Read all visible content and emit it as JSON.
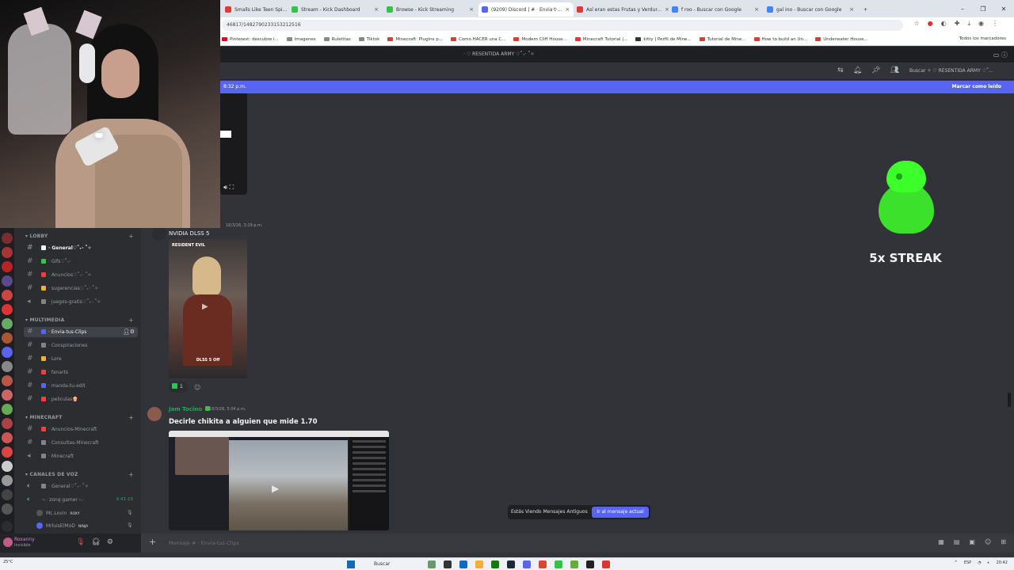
{
  "browser": {
    "tabs": [
      {
        "label": "Smalls Like Teen Spi...",
        "color": "#e23838"
      },
      {
        "label": "Stream - Kick Dashboard",
        "color": "#35c246"
      },
      {
        "label": "Browse - Kick Streaming",
        "color": "#35c246"
      },
      {
        "label": "(9209) Discord | # · Envia·t·...",
        "color": "#5865f2"
      },
      {
        "label": "Así eran estas Frutas y Verdur...",
        "color": "#e23838"
      },
      {
        "label": "f roo - Buscar con Google",
        "color": "#4285f4"
      },
      {
        "label": "gal ino - Buscar con Google",
        "color": "#4285f4"
      }
    ],
    "url": "46817/1482790233153212516",
    "bookmarks": [
      {
        "label": "Pinterest: descubre i...",
        "color": "#e60023"
      },
      {
        "label": "Imagenes",
        "color": "#888"
      },
      {
        "label": "Ruletitas",
        "color": "#888"
      },
      {
        "label": "Tiktok",
        "color": "#888"
      },
      {
        "label": "Minecraft: Plugins p...",
        "color": "#e23838"
      },
      {
        "label": "Como HACER una C...",
        "color": "#e23838"
      },
      {
        "label": "Modern Cliff House...",
        "color": "#e23838"
      },
      {
        "label": "Minecraft Tutorial |...",
        "color": "#e23838"
      },
      {
        "label": "kitty | Perfil de Mine...",
        "color": "#333"
      },
      {
        "label": "Tutorial de Mine...",
        "color": "#e23838"
      },
      {
        "label": "How to build an Un...",
        "color": "#e23838"
      },
      {
        "label": "Underwater House...",
        "color": "#e23838"
      }
    ],
    "bookmarks_all": "Todos los marcadores"
  },
  "discord": {
    "title": "· ♡ RESENTIDA ARMY ♡˚₊‧ ˚✧",
    "search_placeholder": "Buscar ✧ ♡ RESENTIDA ARMY ♡˚...",
    "new_bar_time": "8:32 p.m.",
    "mark_read": "Marcar como leído",
    "categories": {
      "lobby": "LOBBY",
      "multimedia": "MULTIMEDIA",
      "minecraft": "MINECRAFT",
      "voice": "CANALES DE VOZ"
    },
    "channels": [
      {
        "label": "· General♡˚₊‧ ˚✧",
        "color": "#f2f3f5"
      },
      {
        "label": "· Gifs♡˚₊‧",
        "color": "#35c246"
      },
      {
        "label": "· Anuncios♡˚₊‧ ˚✧",
        "color": "#f23f43"
      },
      {
        "label": "· sugerencias♡˚₊‧ ˚✧",
        "color": "#f0b232"
      },
      {
        "label": "· juegos-gratis♡˚₊‧ ˚✧",
        "color": "#80848e"
      },
      {
        "label": "· Envia-tus-Clips",
        "color": "#5865f2"
      },
      {
        "label": "· Conspiraciones",
        "color": "#80848e"
      },
      {
        "label": "· Lore",
        "color": "#f0b232"
      },
      {
        "label": "· fanarts",
        "color": "#f23f43"
      },
      {
        "label": "· manda-tu-edit",
        "color": "#5865f2"
      },
      {
        "label": "· peliculas🍿",
        "color": "#f23f43"
      },
      {
        "label": "· Anuncios-Minecraft",
        "color": "#f23f43"
      },
      {
        "label": "· Consultas-Minecraft",
        "color": "#80848e"
      },
      {
        "label": "· Minecraft",
        "color": "#80848e"
      },
      {
        "label": "· General♡˚₊‧ ˚✧",
        "color": "#80848e"
      },
      {
        "label": "·˖․‧ zonq gamer ˖․‧",
        "color": "#23a55a"
      }
    ],
    "voice_timer": "6:41:15",
    "voice_users": [
      {
        "name": "Mc.Lovin",
        "tag": "ROXY"
      },
      {
        "name": "MrluisElMoD",
        "tag": "NINJA"
      }
    ],
    "user": {
      "name": "Roxanny",
      "status": "Invisible"
    },
    "composer_placeholder": "Mensaje # · Envia-tus-Clips",
    "messages": {
      "m1": {
        "author": "NVIDIA DLSS 5",
        "time": "16/3/26, 3:29 p.m.",
        "clip_game": "RESIDENT EVIL",
        "clip_label": "DLSS 5 Off",
        "reaction_count": "1"
      },
      "m2": {
        "author": "Jam Tocino",
        "time": "16/3/26, 5:04 p.m.",
        "text": "Decirle chikita a alguien que mide 1.70"
      }
    },
    "streak": "5x STREAK",
    "old_messages": "Estás Viendo Mensajes Antiguos",
    "jump_to_present": "Ir al mensaje actual"
  },
  "taskbar": {
    "weather": "25°C",
    "search": "Buscar",
    "lang": "ESP",
    "time": "20:42"
  }
}
